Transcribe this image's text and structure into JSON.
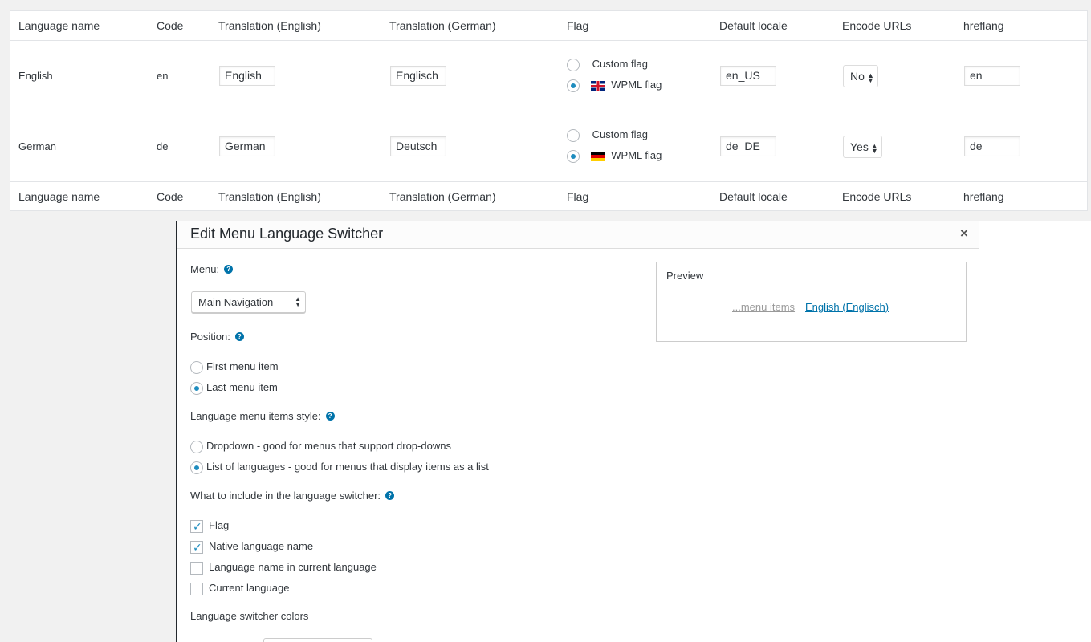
{
  "languages_table": {
    "columns": [
      "Language name",
      "Code",
      "Translation (English)",
      "Translation (German)",
      "Flag",
      "Default locale",
      "Encode URLs",
      "hreflang"
    ],
    "rows": [
      {
        "name": "English",
        "code": "en",
        "trans_en": "English",
        "trans_de": "Englisch",
        "flag_custom": "Custom flag",
        "flag_wpml": "WPML flag",
        "flag_selected": "WPML flag",
        "flag_icon": "uk-flag-icon",
        "locale": "en_US",
        "encode": "No",
        "hreflang": "en"
      },
      {
        "name": "German",
        "code": "de",
        "trans_en": "German",
        "trans_de": "Deutsch",
        "flag_custom": "Custom flag",
        "flag_wpml": "WPML flag",
        "flag_selected": "WPML flag",
        "flag_icon": "german-flag-icon",
        "locale": "de_DE",
        "encode": "Yes",
        "hreflang": "de"
      }
    ]
  },
  "dialog": {
    "title": "Edit Menu Language Switcher",
    "close_glyph": "×",
    "help_glyph": "?",
    "menu_label": "Menu:",
    "menu_value": "Main Navigation",
    "position_label": "Position:",
    "position_options": [
      "First menu item",
      "Last menu item"
    ],
    "position_selected": "Last menu item",
    "style_label": "Language menu items style:",
    "style_options": [
      "Dropdown - good for menus that support drop-downs",
      "List of languages - good for menus that display items as a list"
    ],
    "style_selected": "List of languages - good for menus that display items as a list",
    "include_label": "What to include in the language switcher:",
    "include_options": [
      {
        "label": "Flag",
        "checked": true
      },
      {
        "label": "Native language name",
        "checked": true
      },
      {
        "label": "Language name in current language",
        "checked": false
      },
      {
        "label": "Current language",
        "checked": false
      }
    ],
    "colors_label": "Language switcher colors",
    "preview": {
      "title": "Preview",
      "menu_items": "...menu items",
      "current": "English (Englisch)"
    }
  },
  "colors": {
    "accent": "#0073aa",
    "radio_dot": "#1e8cbe"
  }
}
